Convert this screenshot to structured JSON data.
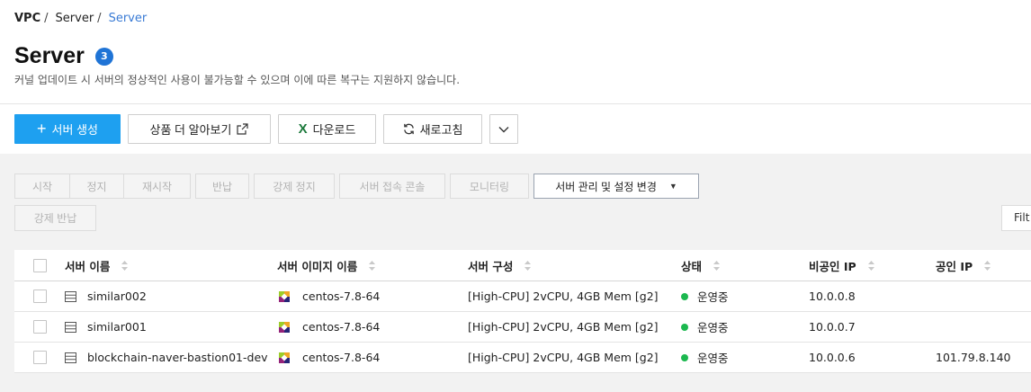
{
  "breadcrumb": {
    "root": "VPC",
    "middle": "Server",
    "current": "Server",
    "separator": "/"
  },
  "page": {
    "title": "Server",
    "count": "3",
    "notice": "커널 업데이트 시 서버의 정상적인 사용이 불가능할 수 있으며 이에 따른 복구는 지원하지 않습니다."
  },
  "toolbar": {
    "create_label": "서버 생성",
    "learn_label": "상품 더 알아보기",
    "download_label": "다운로드",
    "refresh_label": "새로고침",
    "excel_icon_glyph": "X"
  },
  "actions": {
    "start": "시작",
    "stop": "정지",
    "restart": "재시작",
    "return": "반납",
    "force_stop": "강제 정지",
    "console": "서버 접속 콘솔",
    "monitoring": "모니터링",
    "manage": "서버 관리 및 설정 변경",
    "force_return": "강제 반납"
  },
  "filter": {
    "label": "Filt"
  },
  "table": {
    "columns": {
      "name": "서버 이름",
      "image": "서버 이미지 이름",
      "config": "서버 구성",
      "state": "상태",
      "private_ip": "비공인 IP",
      "public_ip": "공인 IP"
    },
    "rows": [
      {
        "name": "similar002",
        "image": "centos-7.8-64",
        "config": "[High-CPU] 2vCPU, 4GB Mem [g2]",
        "state": "운영중",
        "private_ip": "10.0.0.8",
        "public_ip": ""
      },
      {
        "name": "similar001",
        "image": "centos-7.8-64",
        "config": "[High-CPU] 2vCPU, 4GB Mem [g2]",
        "state": "운영중",
        "private_ip": "10.0.0.7",
        "public_ip": ""
      },
      {
        "name": "blockchain-naver-bastion01-dev",
        "image": "centos-7.8-64",
        "config": "[High-CPU] 2vCPU, 4GB Mem [g2]",
        "state": "운영중",
        "private_ip": "10.0.0.6",
        "public_ip": "101.79.8.140"
      }
    ]
  },
  "colors": {
    "primary": "#1ea0f0",
    "badge": "#1f74d6",
    "link": "#3a7bd5",
    "status_running": "#1cb84f",
    "excel": "#1d7a3c"
  },
  "icons": {
    "create": "plus-icon",
    "learn": "external-link-icon",
    "download": "excel-icon",
    "refresh": "refresh-icon",
    "more": "chevron-down-icon",
    "manage": "caret-down-icon",
    "sort": "sort-icon",
    "row": "server-icon",
    "os": "centos-logo-icon",
    "status": "status-dot-icon"
  }
}
